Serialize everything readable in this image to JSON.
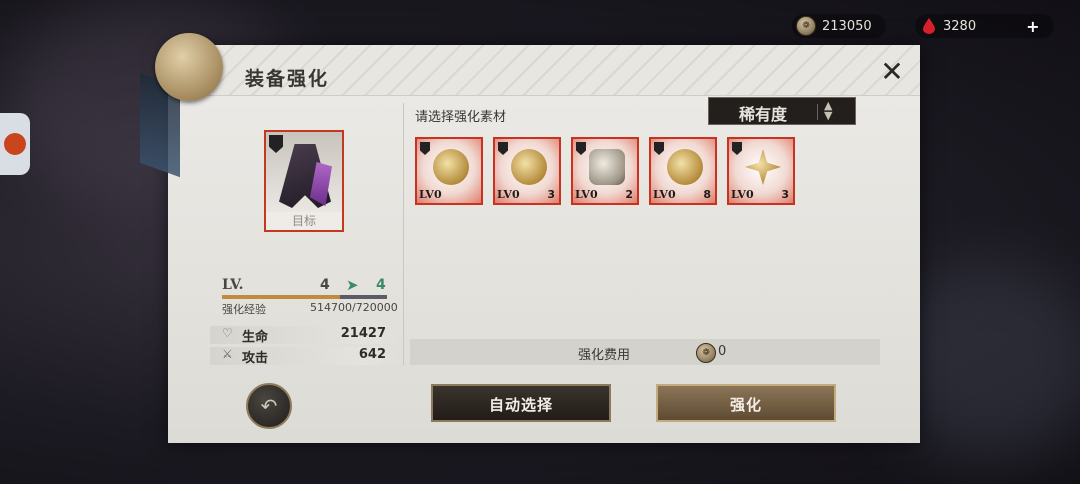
{
  "currency": {
    "coins": "213050",
    "gems": "3280",
    "add": "+"
  },
  "panel": {
    "title": "装备强化",
    "close": "✕"
  },
  "target": {
    "label": "目标"
  },
  "level": {
    "label": "LV.",
    "current": "4",
    "next": "4"
  },
  "exp": {
    "label": "强化经验",
    "value": "514700/720000",
    "progress": 0.715
  },
  "stats": [
    {
      "name": "生命",
      "value": "21427"
    },
    {
      "name": "攻击",
      "value": "642"
    }
  ],
  "materials": {
    "title": "请选择强化素材",
    "rarity_label": "稀有度",
    "items": [
      {
        "level": "LV0",
        "count": ""
      },
      {
        "level": "LV0",
        "count": "3"
      },
      {
        "level": "LV0",
        "count": "2"
      },
      {
        "level": "LV0",
        "count": "8"
      },
      {
        "level": "LV0",
        "count": "3"
      }
    ]
  },
  "cost": {
    "label": "强化费用",
    "value": "0"
  },
  "buttons": {
    "auto_select": "自动选择",
    "enhance": "强化"
  }
}
